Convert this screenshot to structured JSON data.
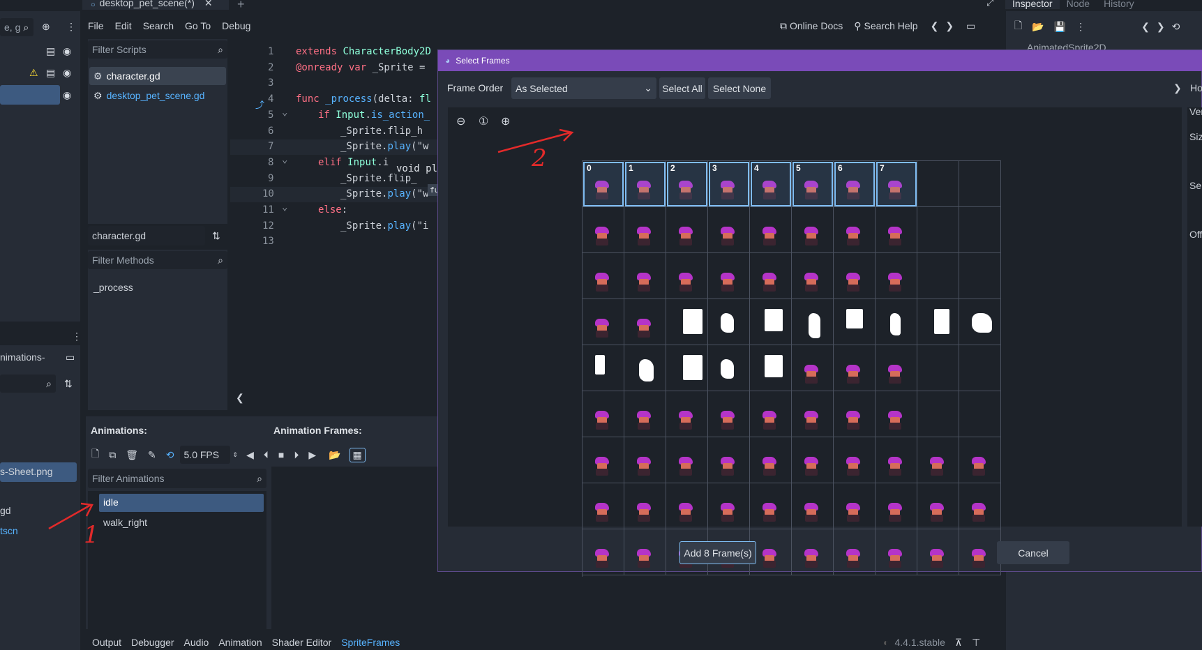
{
  "top_tabs": {
    "scene_tab": "desktop_pet_scene(*)",
    "add_tab": "+"
  },
  "inspector_tabs": [
    "Inspector",
    "Node",
    "History"
  ],
  "left_dock": {
    "filter_text": "e, g",
    "anim_node_label": "nimations-",
    "file1": "s-Sheet.png",
    "file2": "gd",
    "file3": "tscn"
  },
  "menu": [
    "File",
    "Edit",
    "Search",
    "Go To",
    "Debug"
  ],
  "top_right": {
    "online_docs": "Online Docs",
    "search_help": "Search Help"
  },
  "scripts": {
    "filter_placeholder": "Filter Scripts",
    "items": [
      "character.gd",
      "desktop_pet_scene.gd"
    ],
    "current": "character.gd",
    "methods_placeholder": "Filter Methods",
    "methods": [
      "_process"
    ]
  },
  "code": {
    "line_numbers": [
      "1",
      "2",
      "3",
      "4",
      "5",
      "6",
      "7",
      "8",
      "9",
      "10",
      "11",
      "12",
      "13"
    ],
    "lines": [
      [
        {
          "c": "kw",
          "t": "extends "
        },
        {
          "c": "ty",
          "t": "CharacterBody2D"
        }
      ],
      [
        {
          "c": "kw",
          "t": "@onready "
        },
        {
          "c": "kw",
          "t": "var "
        },
        {
          "c": "nm2",
          "t": "_Sprite = "
        }
      ],
      [],
      [
        {
          "c": "kw",
          "t": "func "
        },
        {
          "c": "fn",
          "t": "_process"
        },
        {
          "c": "nm2",
          "t": "(delta: "
        },
        {
          "c": "ty",
          "t": "fl"
        }
      ],
      [
        {
          "c": "kw",
          "t": "if "
        },
        {
          "c": "ty",
          "t": "Input"
        },
        {
          "c": "nm2",
          "t": "."
        },
        {
          "c": "fn",
          "t": "is_action_"
        }
      ],
      [
        {
          "c": "nm2",
          "t": "_Sprite.flip_h "
        }
      ],
      [
        {
          "c": "nm2",
          "t": "_Sprite."
        },
        {
          "c": "fn",
          "t": "play"
        },
        {
          "c": "nm2",
          "t": "(\"w"
        }
      ],
      [
        {
          "c": "kw",
          "t": "elif "
        },
        {
          "c": "ty",
          "t": "Input"
        },
        {
          "c": "nm2",
          "t": ".i"
        }
      ],
      [
        {
          "c": "nm2",
          "t": "_Sprite.flip_"
        }
      ],
      [
        {
          "c": "nm2",
          "t": "_Sprite."
        },
        {
          "c": "fn",
          "t": "play"
        },
        {
          "c": "nm2",
          "t": "(\"w"
        }
      ],
      [
        {
          "c": "kw",
          "t": "else"
        },
        {
          "c": "nm2",
          "t": ":"
        }
      ],
      [
        {
          "c": "nm2",
          "t": "_Sprite."
        },
        {
          "c": "fn",
          "t": "play"
        },
        {
          "c": "nm2",
          "t": "(\"i"
        }
      ],
      []
    ],
    "tooltip": "void pl",
    "tooltip2": "fu"
  },
  "animations_panel": {
    "animations_label": "Animations:",
    "frames_label": "Animation Frames:",
    "fps": "5.0 FPS",
    "filter_placeholder": "Filter Animations",
    "items": [
      "idle",
      "walk_right"
    ]
  },
  "bottom_tabs": [
    "Output",
    "Debugger",
    "Audio",
    "Animation",
    "Shader Editor",
    "SpriteFrames"
  ],
  "version": "4.4.1.stable",
  "inspector": {
    "node_name": "AnimatedSprite2D"
  },
  "dialog": {
    "title": "Select Frames",
    "frame_order_label": "Frame Order",
    "frame_order_value": "As Selected",
    "select_all": "Select All",
    "select_none": "Select None",
    "add_button": "Add 8 Frame(s)",
    "cancel_button": "Cancel",
    "right_labels": [
      "Ho",
      "Ver",
      "Siz",
      "Sep",
      "Off"
    ],
    "selected_frames": [
      "0",
      "1",
      "2",
      "3",
      "4",
      "5",
      "6",
      "7"
    ],
    "grid_rows": 9,
    "grid_cols": 10
  },
  "annotations": [
    "1",
    "2"
  ],
  "colors": {
    "accent": "#7fbcf2",
    "dialog_title": "#7a4bb8",
    "annotation": "#e32a2a"
  }
}
